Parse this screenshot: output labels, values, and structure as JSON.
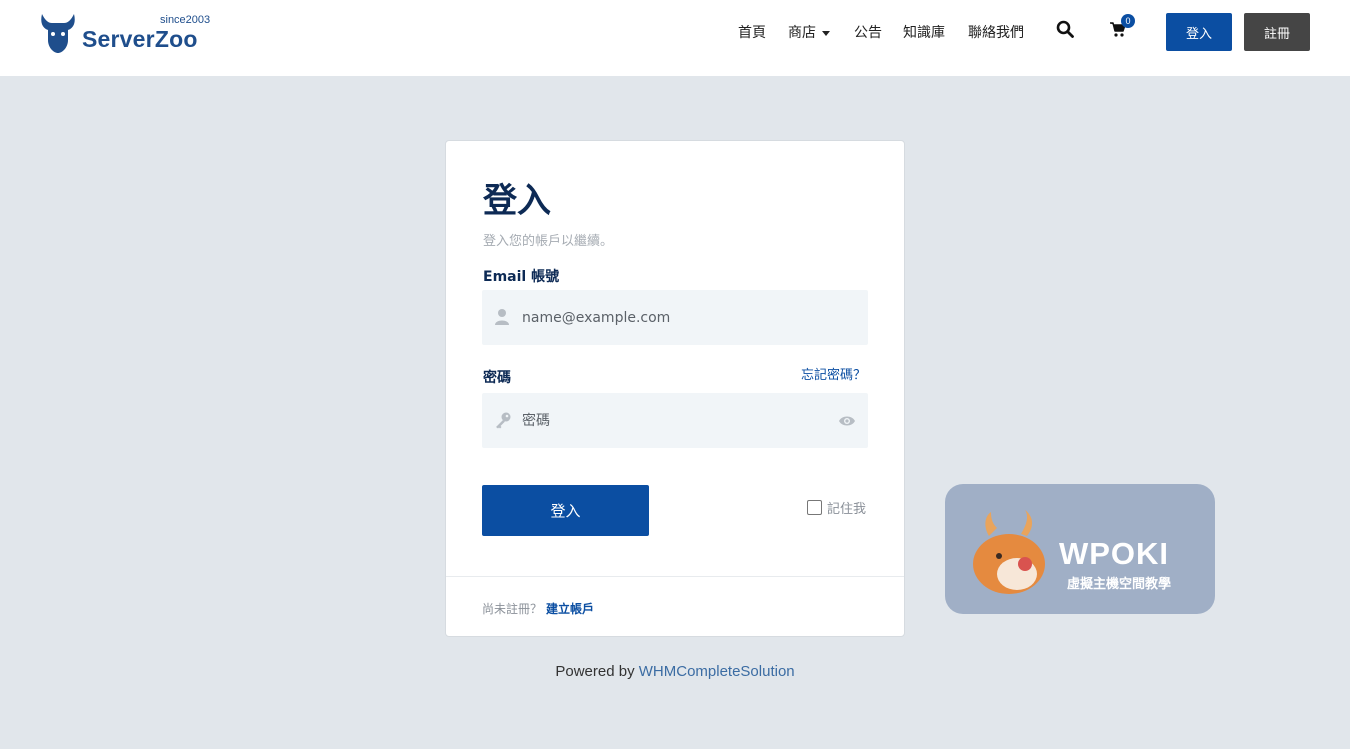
{
  "brand": {
    "since": "since2003",
    "name": "ServerZoo",
    "color": "#1f4e8c"
  },
  "nav": {
    "items": [
      {
        "label": "首頁"
      },
      {
        "label": "商店"
      },
      {
        "label": "公告"
      },
      {
        "label": "知識庫"
      },
      {
        "label": "聯絡我們"
      }
    ],
    "search_icon": "search-icon",
    "cart_icon": "cart-icon",
    "cart_count": "0",
    "login_label": "登入",
    "register_label": "註冊"
  },
  "login": {
    "title": "登入",
    "subtitle": "登入您的帳戶以繼續。",
    "email_label": "Email 帳號",
    "email_placeholder": "name@example.com",
    "password_label": "密碼",
    "forgot_label": "忘記密碼？",
    "password_placeholder": "密碼",
    "submit_label": "登入",
    "remember_label": "記住我",
    "footer_prompt": "尚未註冊？",
    "footer_link": "建立帳戶"
  },
  "powered": {
    "prefix": "Powered by ",
    "link": "WHMCompleteSolution"
  },
  "watermark": {
    "name": "WPOKI",
    "sub": "虛擬主機空間教學"
  },
  "colors": {
    "primary": "#0b4ea2",
    "dark_button": "#454545",
    "background": "#e1e6eb",
    "heading": "#0d2a55"
  }
}
